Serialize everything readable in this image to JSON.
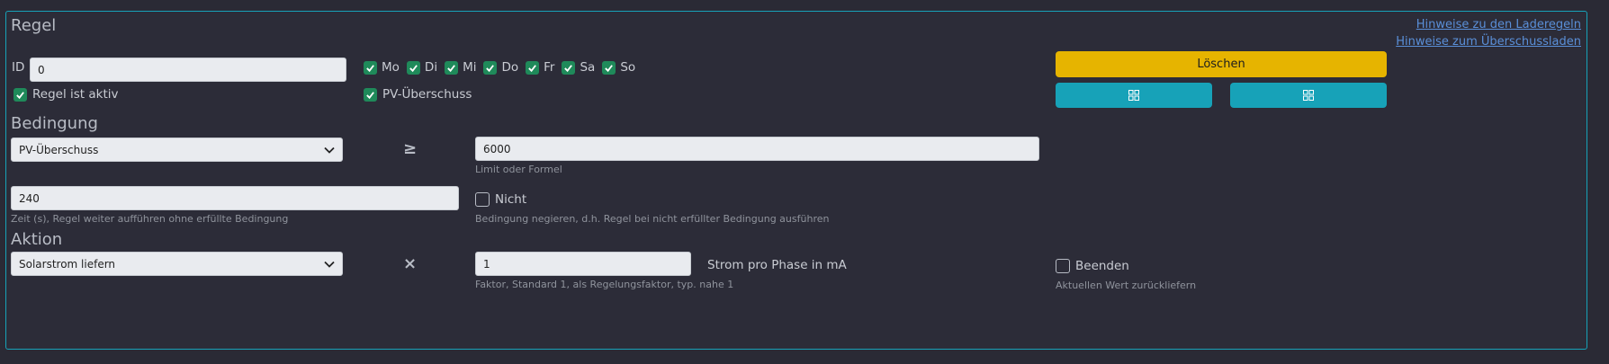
{
  "section": {
    "rule_title": "Regel",
    "condition_title": "Bedingung",
    "action_title": "Aktion"
  },
  "links": {
    "charge_rules_hint": "Hinweise zu den Laderegeln",
    "surplus_hint": "Hinweise zum Überschussladen"
  },
  "rule": {
    "id_label": "ID",
    "id_value": "0",
    "active_label": "Regel ist aktiv",
    "days": [
      {
        "label": "Mo"
      },
      {
        "label": "Di"
      },
      {
        "label": "Mi"
      },
      {
        "label": "Do"
      },
      {
        "label": "Fr"
      },
      {
        "label": "Sa"
      },
      {
        "label": "So"
      }
    ],
    "pv_surplus_label": "PV-Überschuss",
    "delete_label": "Löschen"
  },
  "condition": {
    "source_value": "PV-Überschuss",
    "operator": "≥",
    "limit_value": "6000",
    "limit_hint": "Limit oder Formel",
    "time_value": "240",
    "time_hint": "Zeit (s), Regel weiter aufführen ohne erfüllte Bedingung",
    "not_label": "Nicht",
    "not_hint": "Bedingung negieren, d.h. Regel bei nicht erfüllter Bedingung ausführen"
  },
  "action": {
    "type_value": "Solarstrom liefern",
    "operator": "×",
    "factor_value": "1",
    "factor_hint": "Faktor, Standard 1, als Regelungsfaktor, typ. nahe 1",
    "unit_label": "Strom pro Phase in mA",
    "end_label": "Beenden",
    "end_hint": "Aktuellen Wert zurückliefern"
  },
  "colors": {
    "accent_teal": "#17a2b8",
    "delete_yellow": "#e6b400",
    "checkbox_green": "#1f8a5a"
  }
}
